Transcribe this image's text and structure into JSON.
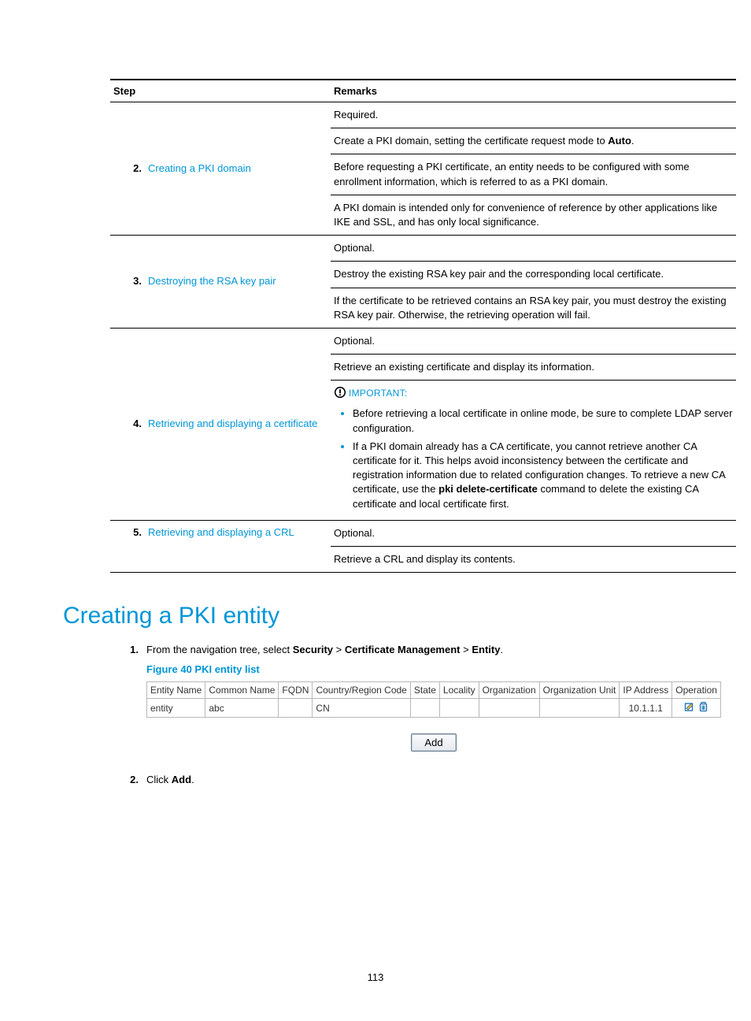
{
  "table": {
    "headers": {
      "step": "Step",
      "remarks": "Remarks"
    },
    "rows": [
      {
        "num": "2.",
        "name": "Creating a PKI domain",
        "remarks": [
          {
            "text": "Required."
          },
          {
            "prefix": "Create a PKI domain, setting the certificate request mode to ",
            "bold": "Auto",
            "suffix": "."
          },
          {
            "text": "Before requesting a PKI certificate, an entity needs to be configured with some enrollment information, which is referred to as a PKI domain."
          },
          {
            "text": "A PKI domain is intended only for convenience of reference by other applications like IKE and SSL, and has only local significance."
          }
        ]
      },
      {
        "num": "3.",
        "name": "Destroying the RSA key pair",
        "remarks": [
          {
            "text": "Optional."
          },
          {
            "text": "Destroy the existing RSA key pair and the corresponding local certificate."
          },
          {
            "text": "If the certificate to be retrieved contains an RSA key pair, you must destroy the existing RSA key pair. Otherwise, the retrieving operation will fail."
          }
        ]
      },
      {
        "num": "4.",
        "name": "Retrieving and displaying a certificate",
        "remarks": [
          {
            "text": "Optional."
          },
          {
            "text": "Retrieve an existing certificate and display its information."
          }
        ],
        "important": {
          "label": "IMPORTANT:",
          "bullets": [
            {
              "text": "Before retrieving a local certificate in online mode, be sure to complete LDAP server configuration."
            },
            {
              "prefix": "If a PKI domain already has a CA certificate, you cannot retrieve another CA certificate for it. This helps avoid inconsistency between the certificate and registration information due to related configuration changes. To retrieve a new CA certificate, use the ",
              "bold": "pki delete-certificate",
              "suffix": " command to delete the existing CA certificate and local certificate first."
            }
          ]
        }
      },
      {
        "num": "5.",
        "name": "Retrieving and displaying a CRL",
        "remarks": [
          {
            "text": "Optional."
          },
          {
            "text": "Retrieve a CRL and display its contents."
          }
        ]
      }
    ]
  },
  "heading": "Creating a PKI entity",
  "steps": [
    {
      "num": "1.",
      "prefix": "From the navigation tree, select ",
      "bold1": "Security",
      "sep1": " > ",
      "bold2": "Certificate Management",
      "sep2": " > ",
      "bold3": "Entity",
      "suffix": "."
    },
    {
      "num": "2.",
      "prefix": "Click ",
      "bold1": "Add",
      "suffix": "."
    }
  ],
  "figure_title": "Figure 40 PKI entity list",
  "entity_table": {
    "headers": [
      "Entity Name",
      "Common Name",
      "FQDN",
      "Country/Region Code",
      "State",
      "Locality",
      "Organization",
      "Organization Unit",
      "IP Address",
      "Operation"
    ],
    "row": {
      "entity_name": "entity",
      "common_name": "abc",
      "fqdn": "",
      "country": "CN",
      "state": "",
      "locality": "",
      "org": "",
      "org_unit": "",
      "ip": "10.1.1.1"
    }
  },
  "add_button": "Add",
  "page_number": "113"
}
